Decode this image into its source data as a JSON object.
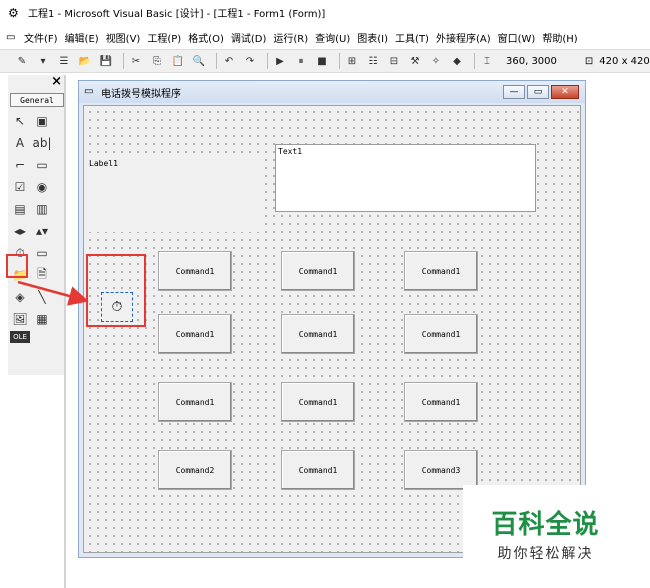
{
  "window": {
    "title": "工程1 - Microsoft Visual Basic [设计] - [工程1 - Form1 (Form)]"
  },
  "menubar": {
    "items": [
      "文件(F)",
      "编辑(E)",
      "视图(V)",
      "工程(P)",
      "格式(O)",
      "调试(D)",
      "运行(R)",
      "查询(U)",
      "图表(I)",
      "工具(T)",
      "外接程序(A)",
      "窗口(W)",
      "帮助(H)"
    ]
  },
  "toolbar": {
    "position_readout": "360, 3000",
    "size_readout": "420 x 420"
  },
  "toolbox": {
    "tab_label": "General",
    "close_label": "×",
    "tools": [
      {
        "name": "pointer-icon",
        "glyph": "↖"
      },
      {
        "name": "picturebox-icon",
        "glyph": "▣"
      },
      {
        "name": "label-icon",
        "glyph": "A"
      },
      {
        "name": "textbox-icon",
        "glyph": "ab|"
      },
      {
        "name": "frame-icon",
        "glyph": "⌐"
      },
      {
        "name": "commandbutton-icon",
        "glyph": "▭"
      },
      {
        "name": "checkbox-icon",
        "glyph": "☑"
      },
      {
        "name": "optionbutton-icon",
        "glyph": "◉"
      },
      {
        "name": "combobox-icon",
        "glyph": "▤"
      },
      {
        "name": "listbox-icon",
        "glyph": "▥"
      },
      {
        "name": "hscrollbar-icon",
        "glyph": "◂▸"
      },
      {
        "name": "vscrollbar-icon",
        "glyph": "▴▾"
      },
      {
        "name": "timer-icon",
        "glyph": "⏱"
      },
      {
        "name": "drivelistbox-icon",
        "glyph": "▭"
      },
      {
        "name": "dirlistbox-icon",
        "glyph": "📁"
      },
      {
        "name": "filelistbox-icon",
        "glyph": "🗎"
      },
      {
        "name": "shape-icon",
        "glyph": "◈"
      },
      {
        "name": "line-icon",
        "glyph": "╲"
      },
      {
        "name": "image-icon",
        "glyph": "🖼"
      },
      {
        "name": "data-icon",
        "glyph": "▦"
      },
      {
        "name": "ole-icon",
        "glyph": "OLE"
      }
    ]
  },
  "form": {
    "title": "电话拨号模拟程序",
    "label1": "Label1",
    "text1": "Text1",
    "buttons": [
      [
        "Command1",
        "Command1",
        "Command1"
      ],
      [
        "Command1",
        "Command1",
        "Command1"
      ],
      [
        "Command1",
        "Command1",
        "Command1"
      ],
      [
        "Command2",
        "Command1",
        "Command3"
      ]
    ],
    "timer_glyph": "⏱"
  },
  "watermark": {
    "main": "百科全说",
    "sub": "助你轻松解决"
  },
  "colors": {
    "highlight": "#e53935",
    "selection": "#1f5fc8",
    "watermark": "#1f8f45"
  }
}
